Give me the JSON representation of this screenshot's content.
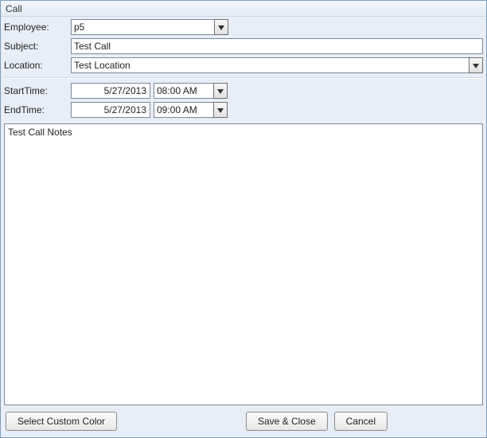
{
  "window": {
    "title": "Call"
  },
  "labels": {
    "employee": "Employee:",
    "subject": "Subject:",
    "location": "Location:",
    "start": "StartTime:",
    "end": "EndTime:"
  },
  "fields": {
    "employee": "p5",
    "subject": "Test Call",
    "location": "Test Location",
    "start_date": "5/27/2013",
    "start_time": "08:00 AM",
    "end_date": "5/27/2013",
    "end_time": "09:00 AM",
    "notes": "Test Call Notes"
  },
  "buttons": {
    "color": "Select Custom Color",
    "save": "Save & Close",
    "cancel": "Cancel"
  }
}
